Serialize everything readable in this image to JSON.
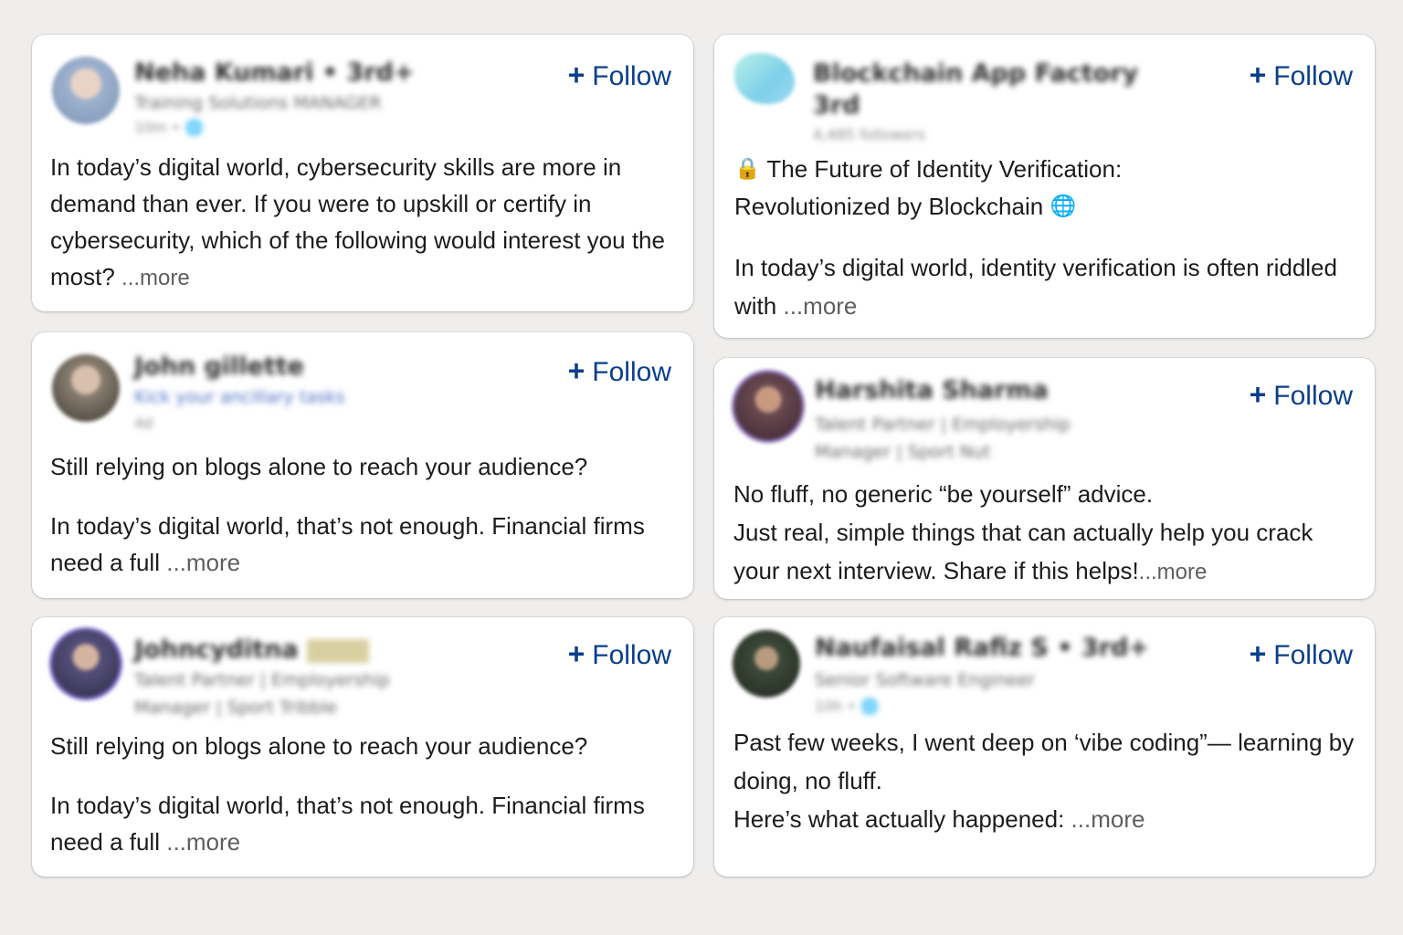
{
  "posts": [
    {
      "author_name": "Neha Kumari • 3rd+",
      "headline": "Training Solutions MANAGER",
      "meta": "10m • 🌐",
      "follow_label": "Follow",
      "avatar_color": "#9fb3cf",
      "paragraphs": [
        "In today’s digital world, cybersecurity skills are more in demand than ever. If you were to upskill or certify in cybersecurity, which of the following would interest you the most?"
      ],
      "more_label": "...more"
    },
    {
      "author_name": "Blockchain App Factory",
      "author_badge": "3rd",
      "headline": "4,485 followers",
      "follow_label": "Follow",
      "avatar_color": "#8fd6cf",
      "title_icon": "🔒",
      "title_lines": [
        "The Future of Identity Verification:",
        "Revolutionized by Blockchain"
      ],
      "title_icon_end": "🌐",
      "paragraphs": [
        "In today’s digital world, identity verification is often riddled with"
      ],
      "more_label": "...more"
    },
    {
      "author_name": "John gillette",
      "headline": "Kick your ancillary tasks",
      "meta": "4d",
      "follow_label": "Follow",
      "avatar_color": "#8a8070",
      "paragraphs": [
        "Still relying on blogs alone to reach your audience?",
        "In today’s digital world, that’s not enough. Financial firms need a full"
      ],
      "more_label": "...more"
    },
    {
      "author_name": "Harshita Sharma",
      "headline": "Talent Partner | Employership",
      "headline2": "Manager | Sport Nut",
      "follow_label": "Follow",
      "avatar_color": "#6b4a52",
      "paragraphs": [
        "No fluff, no generic “be yourself” advice.",
        "Just real, simple things that can actually help you crack your next interview. Share if this helps!"
      ],
      "more_label": "...more"
    },
    {
      "author_name": "Johncyditna",
      "headline": "Talent Partner | Employership",
      "headline2": "Manager | Sport Tribble",
      "follow_label": "Follow",
      "avatar_color": "#55507a",
      "paragraphs": [
        "Still relying on blogs alone to reach your audience?",
        "In today’s digital world, that’s not enough. Financial firms need a full"
      ],
      "more_label": "...more"
    },
    {
      "author_name": "Naufaisal Rafiz S • 3rd+",
      "headline": "Senior Software Engineer",
      "meta": "10h • 🌐",
      "follow_label": "Follow",
      "avatar_color": "#3d4a3a",
      "paragraphs": [
        "Past few weeks, I went deep on ‘vibe coding”— learning by doing, no fluff.",
        "Here’s what actually happened:"
      ],
      "more_label": "...more"
    }
  ]
}
